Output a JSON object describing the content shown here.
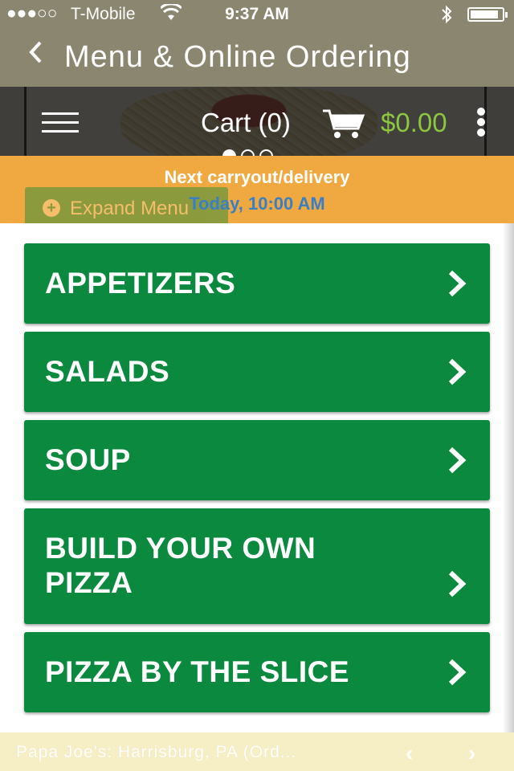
{
  "status_bar": {
    "signal": "●●●○○",
    "carrier": "T-Mobile",
    "time": "9:37 AM",
    "battery_level": 0.9
  },
  "nav": {
    "back_icon": "chevron-left-icon",
    "title": "Menu & Online Ordering"
  },
  "toolbar": {
    "cart_label": "Cart (0)",
    "cart_total": "$0.00",
    "total_color": "#8dc63f"
  },
  "carousel": {
    "page_count": 3,
    "active_index": 0
  },
  "carryout": {
    "label": "Next carryout/delivery",
    "time": "Today, 10:00 AM"
  },
  "expand_menu": {
    "label": "Expand Menu"
  },
  "categories": [
    {
      "line1": "APPETIZERS",
      "line2": ""
    },
    {
      "line1": "SALADS",
      "line2": ""
    },
    {
      "line1": "SOUP",
      "line2": ""
    },
    {
      "line1": "BUILD YOUR OWN",
      "line2": "PIZZA"
    },
    {
      "line1": "PIZZA BY THE SLICE",
      "line2": ""
    }
  ],
  "footer": {
    "location": "Papa Joe's: Harrisburg, PA (Ord..."
  },
  "colors": {
    "header_bg": "#8b8670",
    "category_bg": "#0b8a3f",
    "band_bg": "#f0a940"
  }
}
